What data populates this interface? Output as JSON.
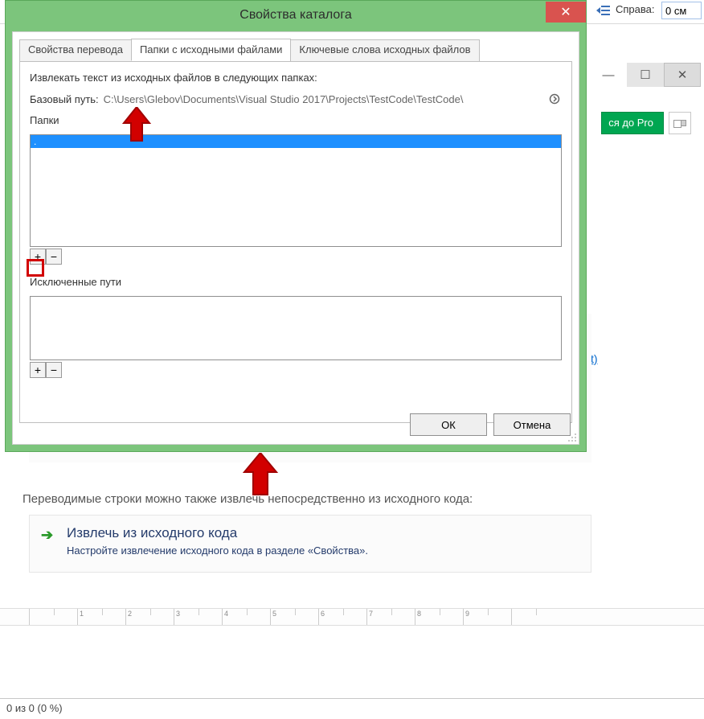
{
  "toolbar_behind": {
    "right_label": "Справа:",
    "right_value": "0 см"
  },
  "window_controls": {
    "min": "—",
    "max": "☐",
    "close": "✕"
  },
  "pro_button": "ся до Pro",
  "link_text": "t)",
  "instruction_text": "Переводимые строки можно также извлечь непосредственно из исходного кода:",
  "extract_card": {
    "heading": "Извлечь из исходного кода",
    "sub": "Настройте извлечение исходного кода в разделе «Свойства»."
  },
  "ruler_numbers": [
    "",
    "1",
    "2",
    "3",
    "4",
    "5",
    "6",
    "7",
    "8",
    "9",
    ""
  ],
  "status_bar": "0 из 0 (0 %)",
  "dialog": {
    "title": "Свойства каталога",
    "close": "✕",
    "tabs": {
      "t1": "Свойства перевода",
      "t2": "Папки с исходными файлами",
      "t3": "Ключевые слова исходных файлов"
    },
    "extract_text": "Извлекать текст из исходных файлов в следующих папках:",
    "base_path_label": "Базовый путь:",
    "base_path_value": "C:\\Users\\Glebov\\Documents\\Visual Studio 2017\\Projects\\TestCode\\TestCode\\",
    "folders_label": "Папки",
    "folders_selected": ".",
    "excluded_label": "Исключенные пути",
    "add": "+",
    "remove": "−",
    "add2": "+",
    "remove2": "−",
    "ok": "ОК",
    "cancel": "Отмена"
  }
}
